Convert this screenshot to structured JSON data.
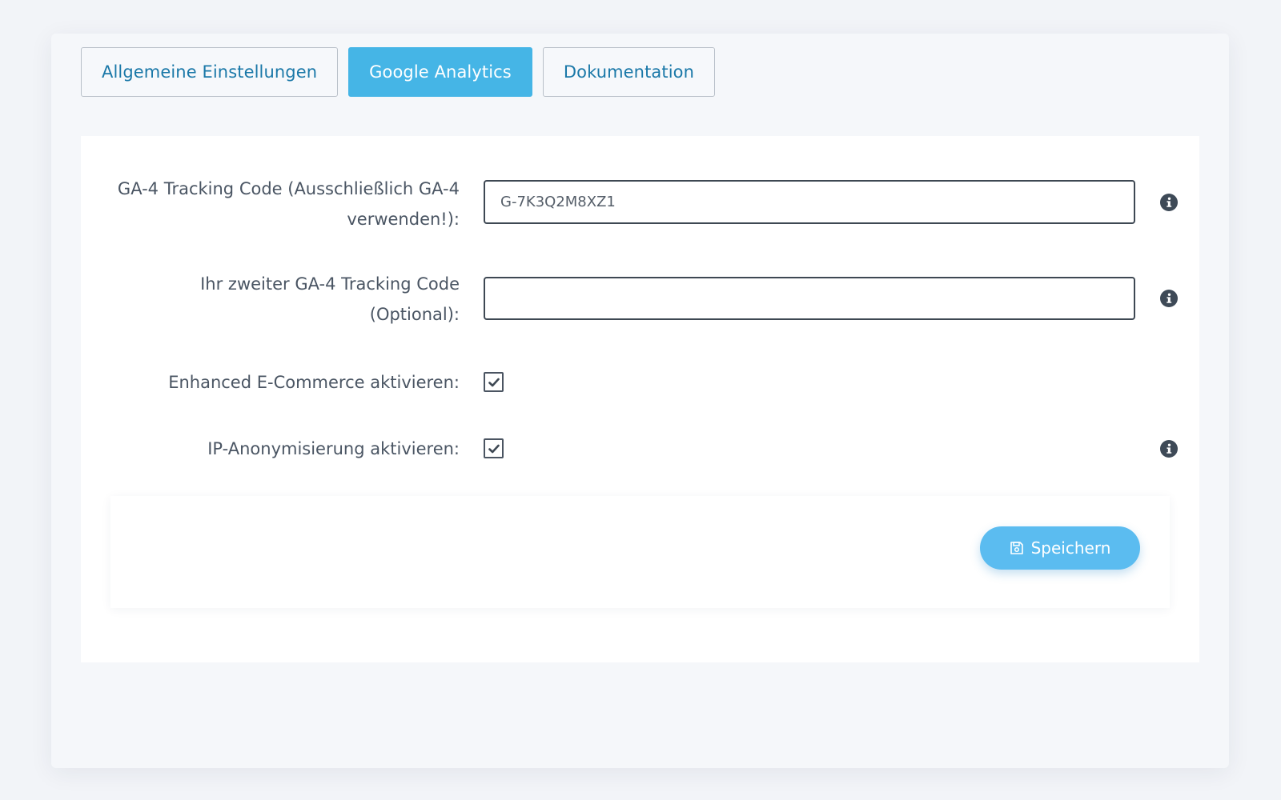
{
  "tabs": [
    {
      "label": "Allgemeine Einstellungen",
      "active": false
    },
    {
      "label": "Google Analytics",
      "active": true
    },
    {
      "label": "Dokumentation",
      "active": false
    }
  ],
  "form": {
    "ga4_tracking_code": {
      "label_line1": "GA-4 Tracking Code (Ausschließlich GA-4",
      "label_line2": "verwenden!):",
      "value": "G-7K3Q2M8XZ1",
      "info_icon": "info-circle-icon"
    },
    "second_ga4_tracking_code": {
      "label_line1": "Ihr zweiter GA-4 Tracking Code",
      "label_line2": "(Optional):",
      "value": "",
      "info_icon": "info-circle-icon"
    },
    "enhanced_ecommerce": {
      "label": "Enhanced E-Commerce aktivieren:",
      "checked": true
    },
    "ip_anonymization": {
      "label": "IP-Anonymisierung aktivieren:",
      "checked": true,
      "info_icon": "info-circle-icon"
    }
  },
  "footer": {
    "save_label": "Speichern",
    "save_icon": "floppy-disk-icon"
  },
  "colors": {
    "accent": "#45b5e6",
    "tab_text": "#1a78a8",
    "save_button": "#5bbcf0",
    "label_text": "#4a5563"
  }
}
